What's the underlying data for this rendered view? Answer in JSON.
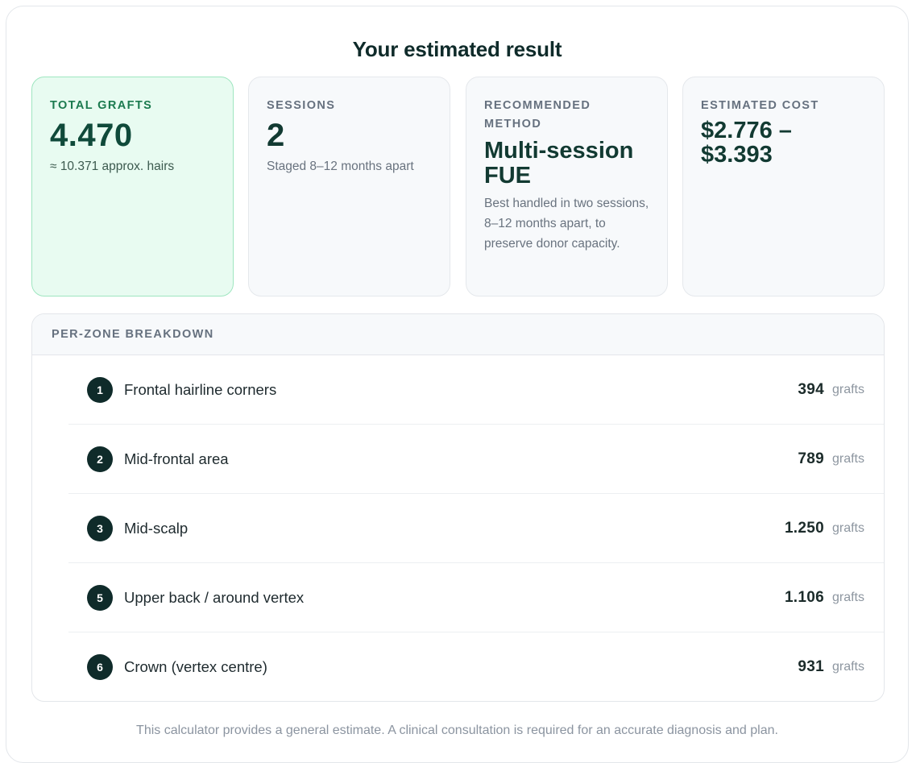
{
  "title": "Your estimated result",
  "stats": [
    {
      "label": "TOTAL GRAFTS",
      "value": "4.470",
      "sub": "≈ 10.371 approx. hairs"
    },
    {
      "label": "SESSIONS",
      "value": "2",
      "sub": "Staged 8–12 months apart"
    },
    {
      "label": "RECOMMENDED METHOD",
      "value": "Multi-session FUE",
      "sub": "Best handled in two sessions, 8–12 months apart, to preserve donor capacity."
    },
    {
      "label": "ESTIMATED COST",
      "value": "$2.776 – $3.393"
    }
  ],
  "breakdown": {
    "heading": "PER-ZONE BREAKDOWN",
    "unit": "grafts",
    "zones": [
      {
        "num": "1",
        "name": "Frontal hairline corners",
        "count": "394"
      },
      {
        "num": "2",
        "name": "Mid-frontal area",
        "count": "789"
      },
      {
        "num": "3",
        "name": "Mid-scalp",
        "count": "1.250"
      },
      {
        "num": "5",
        "name": "Upper back / around vertex",
        "count": "1.106"
      },
      {
        "num": "6",
        "name": "Crown (vertex centre)",
        "count": "931"
      }
    ]
  },
  "disclaimer": "This calculator provides a general estimate. A clinical consultation is required for an accurate diagnosis and plan.",
  "colors": {
    "accent_green": "#1b7a4f",
    "highlight_bg": "#e8fbf1",
    "dark": "#0f2b2a"
  }
}
